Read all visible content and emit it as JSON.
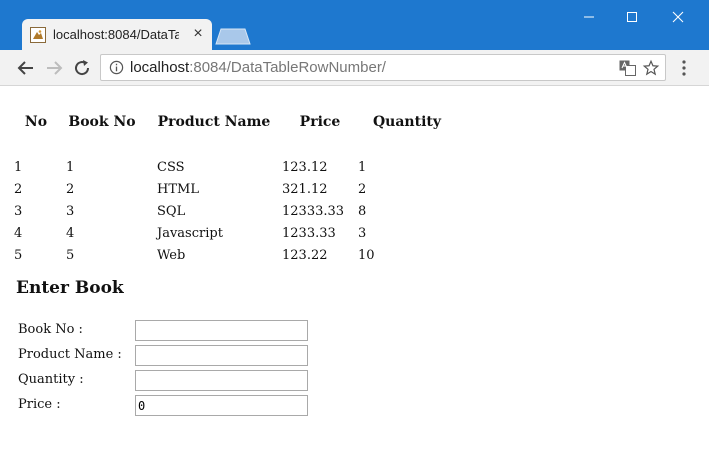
{
  "browser": {
    "tab_title": "localhost:8084/DataTableRowNumber/",
    "tab_close": "×",
    "url_host": "localhost",
    "url_rest": ":8084/DataTableRowNumber/",
    "window_minimize": "—",
    "window_maximize": "☐",
    "window_close": "✕",
    "accent": "#1e78cf"
  },
  "table": {
    "headers": [
      "No",
      "Book No",
      "Product Name",
      "Price",
      "Quantity"
    ],
    "rows": [
      [
        "1",
        "1",
        "CSS",
        "123.12",
        "1"
      ],
      [
        "2",
        "2",
        "HTML",
        "321.12",
        "2"
      ],
      [
        "3",
        "3",
        "SQL",
        "12333.33",
        "8"
      ],
      [
        "4",
        "4",
        "Javascript",
        "1233.33",
        "3"
      ],
      [
        "5",
        "5",
        "Web",
        "123.22",
        "10"
      ]
    ]
  },
  "form": {
    "heading": "Enter Book",
    "book_no_label": "Book No :",
    "book_no_value": "",
    "product_name_label": "Product Name :",
    "product_name_value": "",
    "quantity_label": "Quantity :",
    "quantity_value": "",
    "price_label": "Price :",
    "price_value": "0"
  }
}
